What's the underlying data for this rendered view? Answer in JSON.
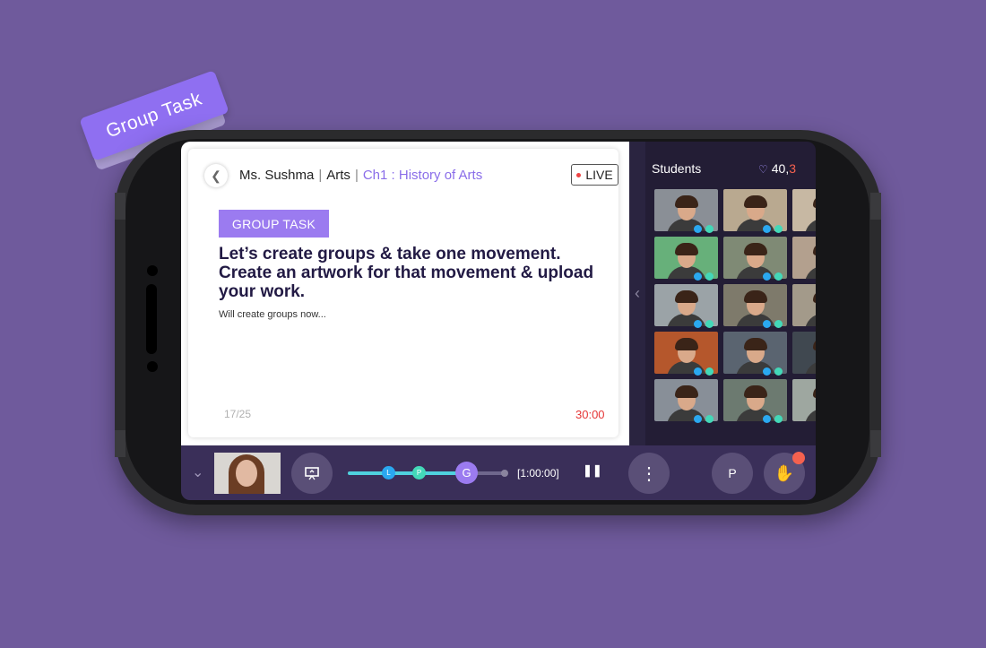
{
  "sticker": {
    "label": "Group Task"
  },
  "header": {
    "teacher": "Ms. Sushma",
    "subject": "Arts",
    "chapter": "Ch1 : History of Arts",
    "live_label": "LIVE"
  },
  "slide": {
    "badge": "GROUP TASK",
    "title": "Let’s create groups & take one movement. Create an artwork for that movement & upload your work.",
    "subtitle": "Will create groups now...",
    "page": "17/25",
    "timer": "30:00"
  },
  "panel": {
    "title": "Students",
    "count_main": "40,",
    "count_alert": "3"
  },
  "controls": {
    "progress_nodes": [
      "L",
      "P",
      "G"
    ],
    "progress_fraction": 0.78,
    "elapsed": "[1:00:00]",
    "profile_initial": "P"
  },
  "colors": {
    "accent": "#9b7bf0",
    "live_red": "#e53535",
    "status_blue": "#2aa8f0",
    "status_teal": "#43d8b8"
  },
  "icons": {
    "back": "chevron-left-icon",
    "present": "presentation-icon",
    "more": "more-vertical-icon",
    "pause": "pause-icon",
    "hand": "raise-hand-icon",
    "collapse": "chevron-down-icon"
  }
}
